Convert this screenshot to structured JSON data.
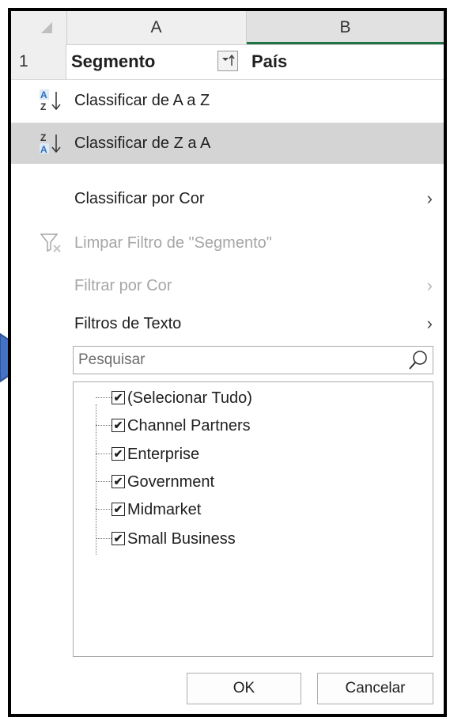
{
  "columns": [
    "A",
    "B"
  ],
  "row_number": "1",
  "cells": {
    "a1": "Segmento",
    "b1": "País"
  },
  "menu": {
    "sort_az": "Classificar de A a Z",
    "sort_za": "Classificar de Z a A",
    "sort_by_color": "Classificar por Cor",
    "clear_filter": "Limpar Filtro de \"Segmento\"",
    "filter_by_color": "Filtrar por Cor",
    "text_filters": "Filtros de Texto"
  },
  "search": {
    "placeholder": "Pesquisar"
  },
  "filter_items": [
    "(Selecionar Tudo)",
    "Channel Partners",
    "Enterprise",
    "Government",
    "Midmarket",
    "Small Business"
  ],
  "buttons": {
    "ok": "OK",
    "cancel": "Cancelar"
  },
  "colors": {
    "accent": "#217346",
    "highlight": "#d4d4d4",
    "arrow_fill": "#4472c4",
    "arrow_border": "#2f5597"
  }
}
